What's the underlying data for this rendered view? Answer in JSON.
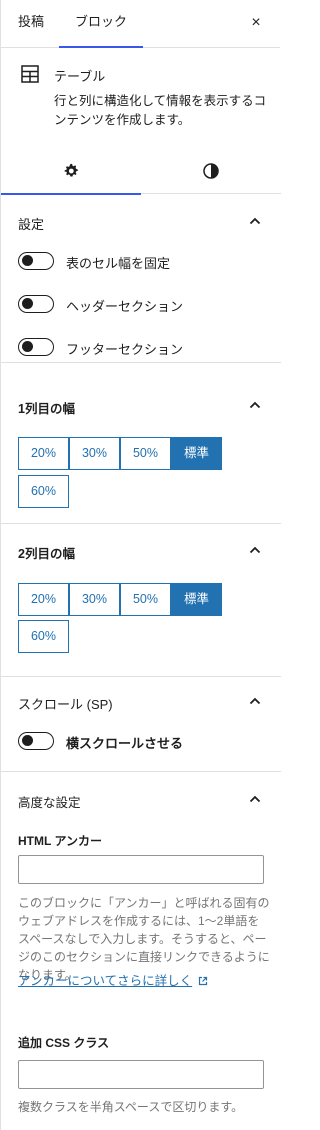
{
  "header": {
    "tabs": [
      {
        "label": "投稿"
      },
      {
        "label": "ブロック"
      }
    ],
    "close_label": "×"
  },
  "block_card": {
    "icon": "table-icon",
    "title": "テーブル",
    "description": "行と列に構造化して情報を表示するコンテンツを作成します。"
  },
  "sub_tabs": [
    {
      "name": "settings",
      "icon": "gear-icon"
    },
    {
      "name": "styles",
      "icon": "contrast-icon"
    }
  ],
  "settings": {
    "title": "設定",
    "toggles": [
      {
        "label": "表のセル幅を固定",
        "checked": false
      },
      {
        "label": "ヘッダーセクション",
        "checked": false
      },
      {
        "label": "フッターセクション",
        "checked": false
      }
    ]
  },
  "col1": {
    "title": "1列目の幅",
    "options": [
      "20%",
      "30%",
      "50%",
      "標準",
      "60%"
    ],
    "selected": "標準"
  },
  "col2": {
    "title": "2列目の幅",
    "options": [
      "20%",
      "30%",
      "50%",
      "標準",
      "60%"
    ],
    "selected": "標準"
  },
  "scroll": {
    "title": "スクロール (SP)",
    "toggle": {
      "label": "横スクロールさせる",
      "checked": false
    }
  },
  "advanced": {
    "title": "高度な設定",
    "anchor_label": "HTML アンカー",
    "anchor_value": "",
    "anchor_help": "このブロックに「アンカー」と呼ばれる固有のウェブアドレスを作成するには、1〜2単語をスペースなしで入力します。そうすると、ページのこのセクションに直接リンクできるようになります。",
    "anchor_link": "アンカーについてさらに詳しく",
    "css_label": "追加 CSS クラス",
    "css_value": "",
    "css_help": "複数クラスを半角スペースで区切ります。"
  },
  "colors": {
    "accent": "#2271b1",
    "tab_underline": "#3858e9"
  }
}
